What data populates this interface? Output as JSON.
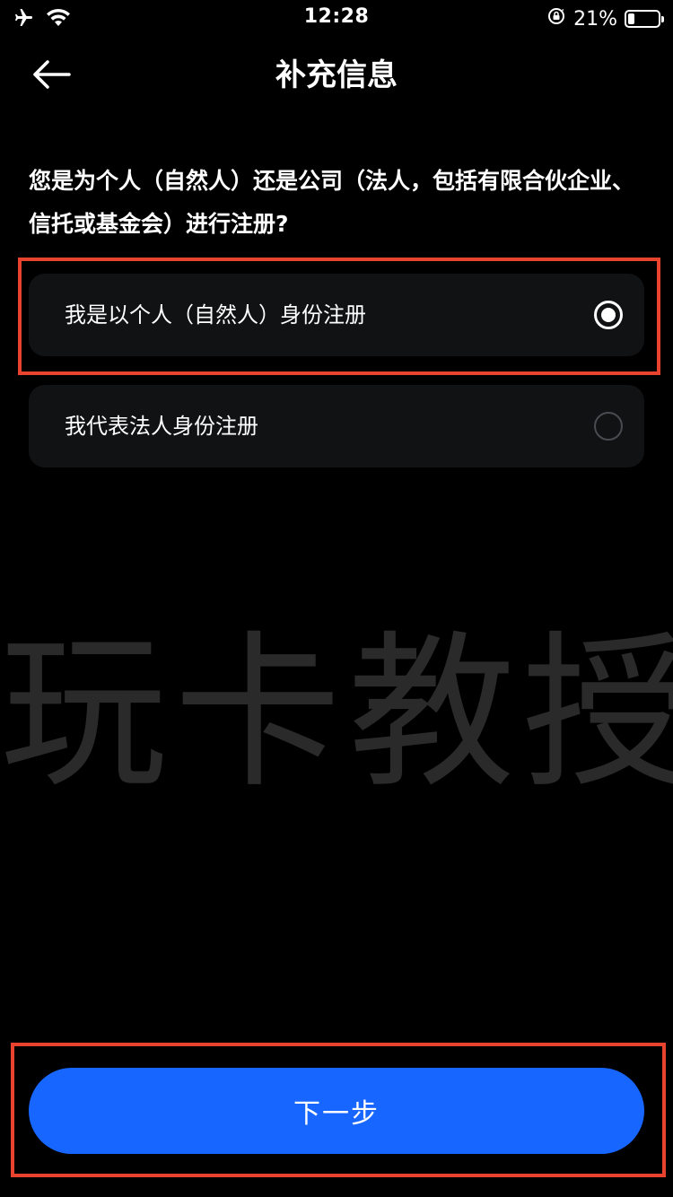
{
  "status_bar": {
    "time": "12:28",
    "battery_percent_text": "21%",
    "battery_level": 0.21,
    "icons": [
      "airplane-icon",
      "wifi-icon",
      "orientation-lock-icon",
      "battery-icon"
    ]
  },
  "nav": {
    "title": "补充信息",
    "back_icon": "arrow-left-icon"
  },
  "question": "您是为个人（自然人）还是公司（法人，包括有限合伙企业、信托或基金会）进行注册?",
  "options": [
    {
      "label": "我是以个人（自然人）身份注册",
      "selected": true
    },
    {
      "label": "我代表法人身份注册",
      "selected": false
    }
  ],
  "watermark": "玩卡教授",
  "next_button": {
    "label": "下一步"
  },
  "colors": {
    "background": "#000000",
    "option_bg": "#111214",
    "accent": "#1766ff",
    "highlight": "#e8432e",
    "watermark": "#2a2a2a"
  }
}
